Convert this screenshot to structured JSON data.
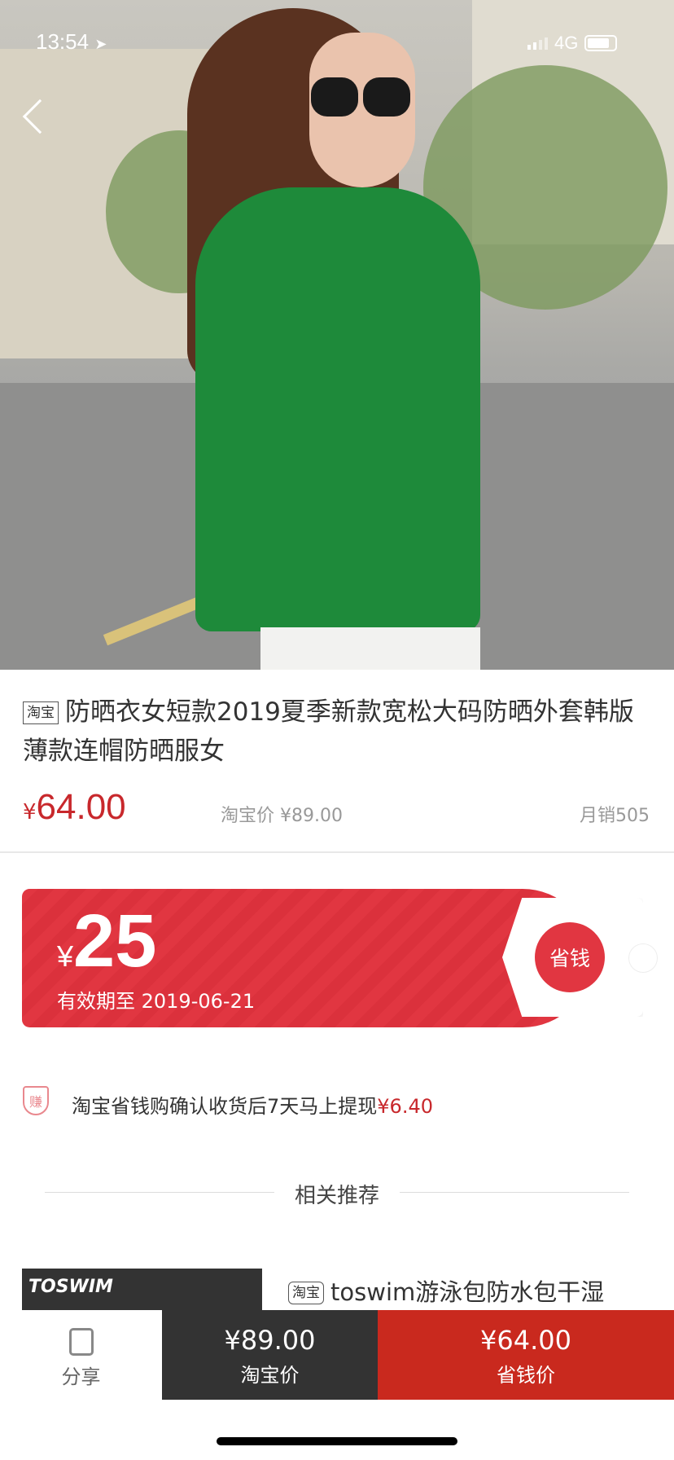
{
  "status_bar": {
    "time": "13:54",
    "network": "4G"
  },
  "product": {
    "source_tag": "淘宝",
    "title": "防晒衣女短款2019夏季新款宽松大码防晒外套韩版薄款连帽防晒服女",
    "price_symbol": "¥",
    "price": "64.00",
    "taobao_price_label": "淘宝价 ¥89.00",
    "monthly_sales": "月销505"
  },
  "coupon": {
    "symbol": "¥",
    "amount": "25",
    "validity": "有效期至 2019-06-21",
    "button": "省钱"
  },
  "earn": {
    "icon_char": "赚",
    "text": "淘宝省钱购确认收货后7天马上提现",
    "amount": "¥6.40"
  },
  "related": {
    "heading": "相关推荐",
    "item": {
      "brand": "TOSWIM",
      "source_tag": "淘宝",
      "title": "toswim游泳包防水包干湿"
    }
  },
  "bottom_bar": {
    "share": "分享",
    "taobao": {
      "price": "¥89.00",
      "label": "淘宝价"
    },
    "save": {
      "price": "¥64.00",
      "label": "省钱价"
    }
  },
  "colors": {
    "price_red": "#c8282c",
    "coupon_red": "#e13641",
    "save_red": "#c9291e",
    "dark": "#333333"
  }
}
